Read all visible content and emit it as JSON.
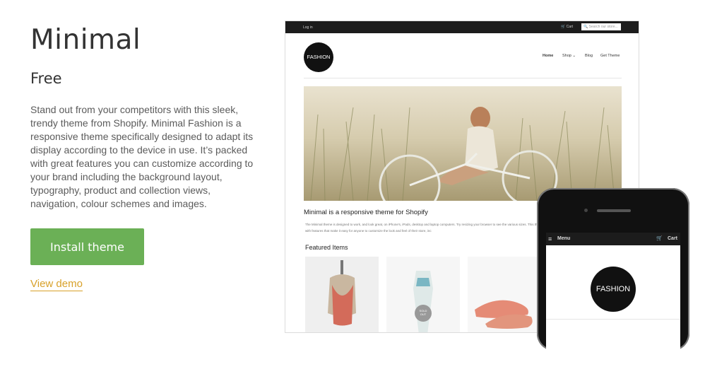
{
  "theme": {
    "name": "Minimal",
    "price": "Free",
    "description": "Stand out from your competitors with this sleek, trendy theme from Shopify. Minimal Fashion is a responsive theme specifically designed to adapt its display according to the device in use. It’s packed with great features you can customize according to your brand including the background layout, typography, product and collection views, navigation, colour schemes and images.",
    "install_label": "Install theme",
    "demo_label": "View demo"
  },
  "desktop_preview": {
    "topbar": {
      "login": "Log in",
      "cart": "Cart",
      "search_placeholder": "Search our store..."
    },
    "logo": "FASHION",
    "nav": [
      "Home",
      "Shop",
      "Blog",
      "Get Theme"
    ],
    "tagline": "Minimal is a responsive theme for Shopify",
    "body": "The Minimal theme is designed to work, and look great, on iPhone's, iPads, desktop and laptop computers. Try resizing your browser to see the various sizes. This theme is packed with features that make it easy for anyone to customize the look and feel of their store, inc",
    "featured_title": "Featured Items",
    "sold_out": "SOLD OUT"
  },
  "mobile_preview": {
    "menu": "Menu",
    "cart": "Cart",
    "logo": "FASHION"
  },
  "colors": {
    "install_bg": "#6bb056",
    "demo_link": "#d8a12a",
    "dark_bar": "#1c1c1c"
  }
}
